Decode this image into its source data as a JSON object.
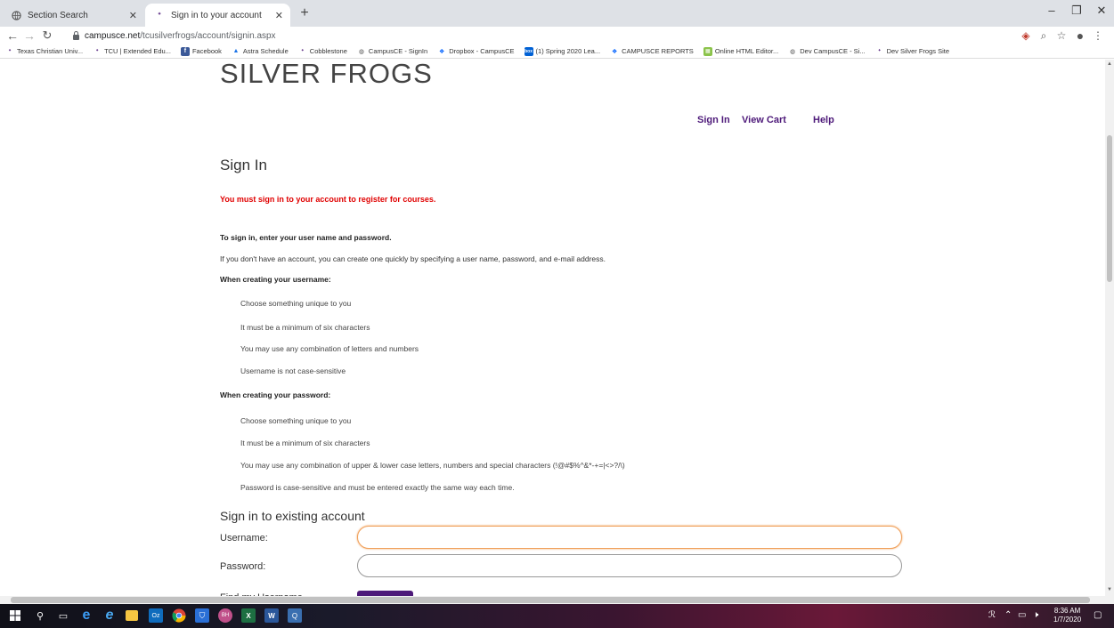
{
  "browser": {
    "tabs": [
      {
        "label": "Section Search",
        "icon": "globe-icon",
        "active": false
      },
      {
        "label": "Sign in to your account",
        "icon": "tcu-favicon-icon",
        "active": true
      }
    ],
    "address": {
      "domain": "campusce.net",
      "path": "/tcusilverfrogs/account/signin.aspx"
    },
    "bookmarks": [
      {
        "label": "Texas Christian Univ...",
        "icon": "tcu-favicon-icon"
      },
      {
        "label": "TCU | Extended Edu...",
        "icon": "tcu-favicon-icon"
      },
      {
        "label": "Facebook",
        "icon": "facebook-icon"
      },
      {
        "label": "Astra Schedule",
        "icon": "astra-icon"
      },
      {
        "label": "Cobblestone",
        "icon": "tcu-favicon-icon"
      },
      {
        "label": "CampusCE - SignIn",
        "icon": "globe-icon"
      },
      {
        "label": "Dropbox - CampusCE",
        "icon": "dropbox-icon"
      },
      {
        "label": "(1) Spring 2020 Lea...",
        "icon": "box-icon"
      },
      {
        "label": "CAMPUSCE REPORTS",
        "icon": "dropbox-icon"
      },
      {
        "label": "Online HTML Editor...",
        "icon": "html-editor-icon"
      },
      {
        "label": "Dev CampusCE - Si...",
        "icon": "globe-icon"
      },
      {
        "label": "Dev Silver Frogs Site",
        "icon": "tcu-favicon-icon"
      }
    ]
  },
  "site": {
    "logo": "SILVER FROGS",
    "nav": {
      "signin": "Sign In",
      "cart": "View Cart",
      "help": "Help"
    }
  },
  "content": {
    "heading": "Sign In",
    "warning": "You must sign in to your account to register for courses.",
    "intro_bold": "To sign in, enter your user name and password.",
    "intro": "If you don't have an account, you can create one quickly by specifying a user name, password, and e-mail address.",
    "username_heading": "When creating your username:",
    "username_rules": [
      "Choose something unique to you",
      "It must be a minimum of six characters",
      "You may use any combination of letters and numbers",
      "Username is not case-sensitive"
    ],
    "password_heading": "When creating your password:",
    "password_rules": [
      "Choose something unique to you",
      "It must be a minimum of six characters",
      "You may use any combination of upper & lower case letters, numbers and special characters (!@#$%^&*-+=|<>?/\\)",
      "Password is case-sensitive and must be entered exactly the same way each time."
    ]
  },
  "form": {
    "heading": "Sign in to existing account",
    "username_label": "Username:",
    "username_value": "",
    "password_label": "Password:",
    "password_value": "",
    "next_label_partial": "Find my Username"
  },
  "taskbar": {
    "time": "8:36 AM",
    "date": "1/7/2020"
  },
  "colors": {
    "brand_purple": "#4d1979",
    "warning_red": "#e00000",
    "focus_orange": "#f0a05a"
  }
}
